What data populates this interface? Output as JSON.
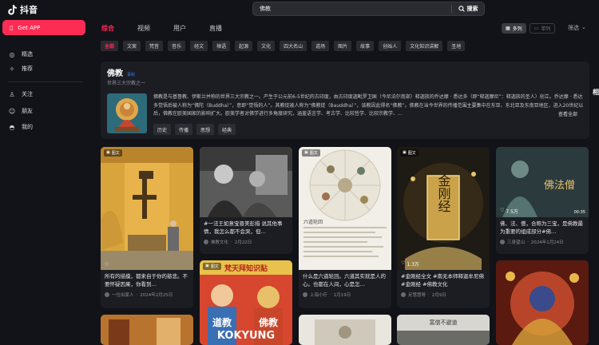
{
  "sidebar": {
    "logo_text": "抖音",
    "get_app": "Get APP",
    "items": [
      {
        "label": "精选",
        "icon": "compass-icon"
      },
      {
        "label": "推荐",
        "icon": "sparkle-icon"
      },
      {
        "label": "关注",
        "icon": "person-icon"
      },
      {
        "label": "朋友",
        "icon": "friends-icon"
      },
      {
        "label": "我的",
        "icon": "user-icon"
      }
    ]
  },
  "search": {
    "query": "佛教",
    "button": "搜索"
  },
  "tabs": [
    "综合",
    "视频",
    "用户",
    "直播"
  ],
  "view": {
    "multi": "多列",
    "single": "单列"
  },
  "filter_label": "筛选",
  "chips": [
    "全部",
    "文案",
    "梵音",
    "音乐",
    "经文",
    "禅语",
    "起源",
    "文化",
    "四大名山",
    "道场",
    "图片",
    "故事",
    "创始人",
    "文化知识讲解",
    "圣地"
  ],
  "encyclopedia": {
    "title": "佛教",
    "badge": "百科",
    "subtitle": "世界三大宗教之一",
    "description": "佛教是与基督教、伊斯兰并称的世界三大宗教之一。产生于公元前6-5世纪的古印度，由古印度迦毗罗卫国（今尼泊尔南部）释迦族的乔达摩 · 悉达多（即“释迦摩尼”：释迦族的圣人）创立。乔达摩 · 悉达多觉悟后被人称为“佛陀（Buddha）”，意即“觉悟的人”。其教徒被人称为“佛教徒（Bauddha）”，该教因此得名“佛教”。佛教在当今世界的传播范围主要集中在东亚、东北亚及东南亚地区，进入20世纪以后，佛教在欧美国家的影响扩大。欧美学者对佛学进行多角度研究，涵盖语言学、考古学、比较哲学、比较宗教学、...",
    "more": "查看全部",
    "tags": [
      "历史",
      "传播",
      "思想",
      "经典"
    ]
  },
  "cards": [
    {
      "badge": "图文",
      "likes": "",
      "duration": "",
      "title": "所有的描摸，都来自于你的慈悲。不要怀疑因果，你看到…",
      "author": "一位出家人",
      "date": "2024年2月25日"
    },
    {
      "badge": "",
      "likes": "",
      "duration": "",
      "title": "#一法王如意宝晋美彭措 说其他事情，我怎么都不会哭，但…",
      "author": "佛教文化",
      "date": "2月22日"
    },
    {
      "badge": "图文",
      "likes": "",
      "duration": "",
      "title": "什么是六道轮回。六道其实就是人的心。也都在人间，心是怎…",
      "author": "上海小疗",
      "date": "1月19日"
    },
    {
      "badge": "图文",
      "likes": "1.3万",
      "duration": "",
      "title": "#金刚经全文 #南无本师释迦牟尼佛 #金刚经 #佛教文化",
      "author": "足慧慧呀",
      "date": "2月9日"
    },
    {
      "badge": "",
      "likes": "7.5万",
      "duration": "00:35",
      "title": "佛、法、僧，合称为三宝，是佛教最为重要的组成部分#佛…",
      "author": "三身望山",
      "date": "2024年1月24日"
    }
  ],
  "thumb_text": {
    "card2_title": "六道轮回",
    "card3_title": "金刚经",
    "card4_title": "佛法僧",
    "card6_banner": "梵天拜知识贴",
    "card6_left": "道教",
    "card6_right": "佛教",
    "card6_watermark": "KOKYUNG",
    "card7_banner": "富僧不避道"
  },
  "right_edge": "相"
}
